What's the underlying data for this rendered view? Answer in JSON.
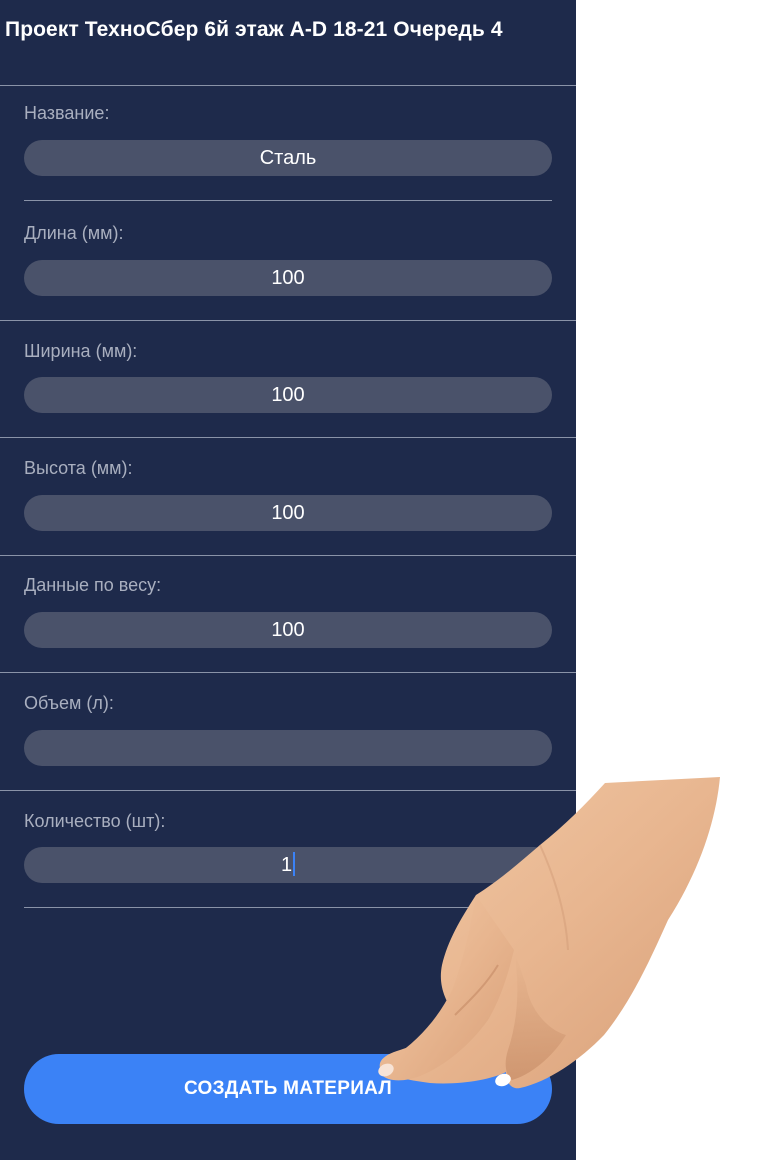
{
  "header": {
    "title": "Проект ТехноСбер 6й этаж A-D 18-21 Очередь 4"
  },
  "form": {
    "fields": [
      {
        "label": "Название:",
        "value": "Сталь"
      },
      {
        "label": "Длина (мм):",
        "value": "100"
      },
      {
        "label": "Ширина (мм):",
        "value": "100"
      },
      {
        "label": "Высота (мм):",
        "value": "100"
      },
      {
        "label": "Данные по весу:",
        "value": "100"
      },
      {
        "label": "Объем (л):",
        "value": ""
      },
      {
        "label": "Количество (шт):",
        "value": "1"
      }
    ]
  },
  "actions": {
    "create_label": "СОЗДАТЬ МАТЕРИАЛ"
  },
  "colors": {
    "background": "#1e2a4b",
    "input": "#4a526a",
    "label": "#a9afbf",
    "accent": "#3b82f6",
    "divider": "#8a93a8"
  },
  "overlay": {
    "icon": "pointing-hand-icon"
  }
}
